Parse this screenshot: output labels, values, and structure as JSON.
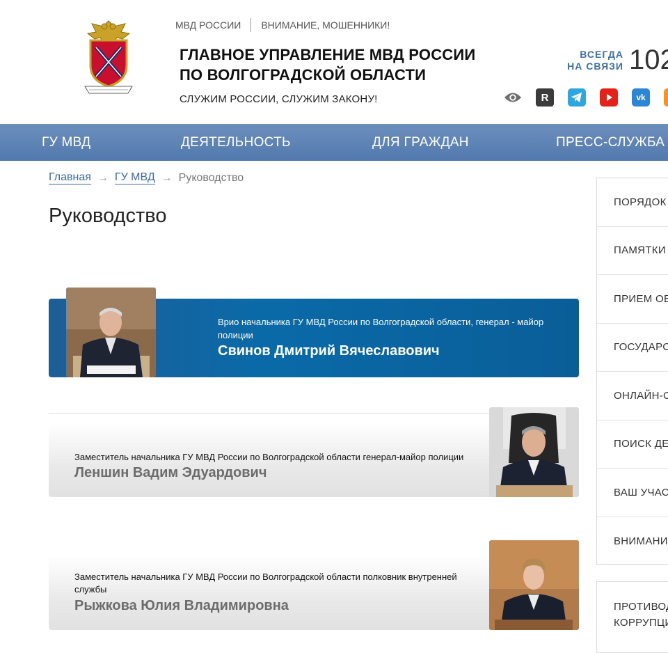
{
  "header": {
    "top_links": [
      "МВД РОССИИ",
      "ВНИМАНИЕ, МОШЕННИКИ!"
    ],
    "title_line1": "ГЛАВНОЕ УПРАВЛЕНИЕ МВД РОССИИ",
    "title_line2": "ПО ВОЛГОГРАДСКОЙ ОБЛАСТИ",
    "slogan": "СЛУЖИМ РОССИИ, СЛУЖИМ ЗАКОНУ!",
    "always_line1": "ВСЕГДА",
    "always_line2": "НА СВЯЗИ",
    "phone": "102",
    "social_icons": [
      "eye-icon",
      "rutube-icon",
      "telegram-icon",
      "youtube-icon",
      "vk-icon",
      "ok-icon"
    ],
    "social_r_label": "R",
    "social_vk_label": "vk"
  },
  "nav": [
    "ГУ МВД",
    "ДЕЯТЕЛЬНОСТЬ",
    "ДЛЯ ГРАЖДАН",
    "ПРЕСС-СЛУЖБА"
  ],
  "breadcrumb": {
    "home": "Главная",
    "section": "ГУ МВД",
    "current": "Руководство",
    "arrow": "→"
  },
  "page_title": "Руководство",
  "leaders": [
    {
      "position": "Врио начальника ГУ МВД России по Волгоградской области, генерал - майор полиции",
      "name": "Свинов Дмитрий Вячеславович"
    },
    {
      "position": "Заместитель начальника ГУ МВД России по Волгоградской области генерал-майор полиции",
      "name": "Леншин Вадим Эдуардович"
    },
    {
      "position": "Заместитель начальника ГУ МВД России по Волгоградской области полковник внутренней службы",
      "name": "Рыжкова Юлия Владимировна"
    }
  ],
  "sidebar": {
    "items": [
      "ПОРЯДОК",
      "ПАМЯТКИ",
      "ПРИЕМ ОБ",
      "ГОСУДАРСТ",
      "ОНЛАЙН-С",
      "ПОИСК ДЕ",
      "ВАШ УЧАСТ",
      "ВНИМАНИ"
    ],
    "box2_text": "ПРОТИВОД\nКОРРУПЦИ"
  },
  "colors": {
    "nav_bg": "#5f84b6",
    "primary_card": "#0a6aa8",
    "accent_text": "#3d6fa8"
  }
}
